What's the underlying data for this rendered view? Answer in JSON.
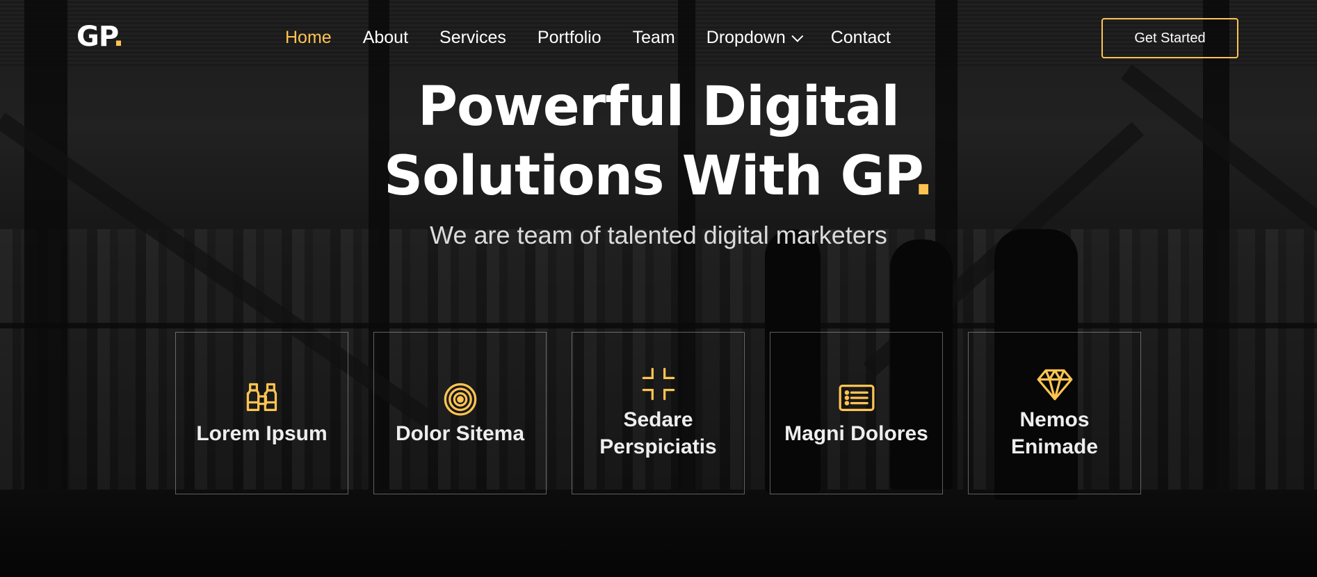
{
  "brand": {
    "name": "GP",
    "dot": ".",
    "accent_color": "#ffc451"
  },
  "nav": {
    "items": [
      {
        "label": "Home",
        "active": true
      },
      {
        "label": "About"
      },
      {
        "label": "Services"
      },
      {
        "label": "Portfolio"
      },
      {
        "label": "Team"
      },
      {
        "label": "Dropdown",
        "has_chevron": true
      },
      {
        "label": "Contact"
      }
    ],
    "cta_label": "Get Started"
  },
  "hero": {
    "title_line1": "Powerful Digital",
    "title_line2": "Solutions With GP",
    "title_dot": ".",
    "subtitle": "We are team of talented digital marketers"
  },
  "features": [
    {
      "icon": "binoculars-icon",
      "label": "Lorem Ipsum"
    },
    {
      "icon": "bullseye-icon",
      "label": "Dolor Sitema"
    },
    {
      "icon": "fullscreen-exit-icon",
      "label": "Sedare Perspiciatis"
    },
    {
      "icon": "card-list-icon",
      "label": "Magni Dolores"
    },
    {
      "icon": "gem-icon",
      "label": "Nemos Enimade"
    }
  ]
}
